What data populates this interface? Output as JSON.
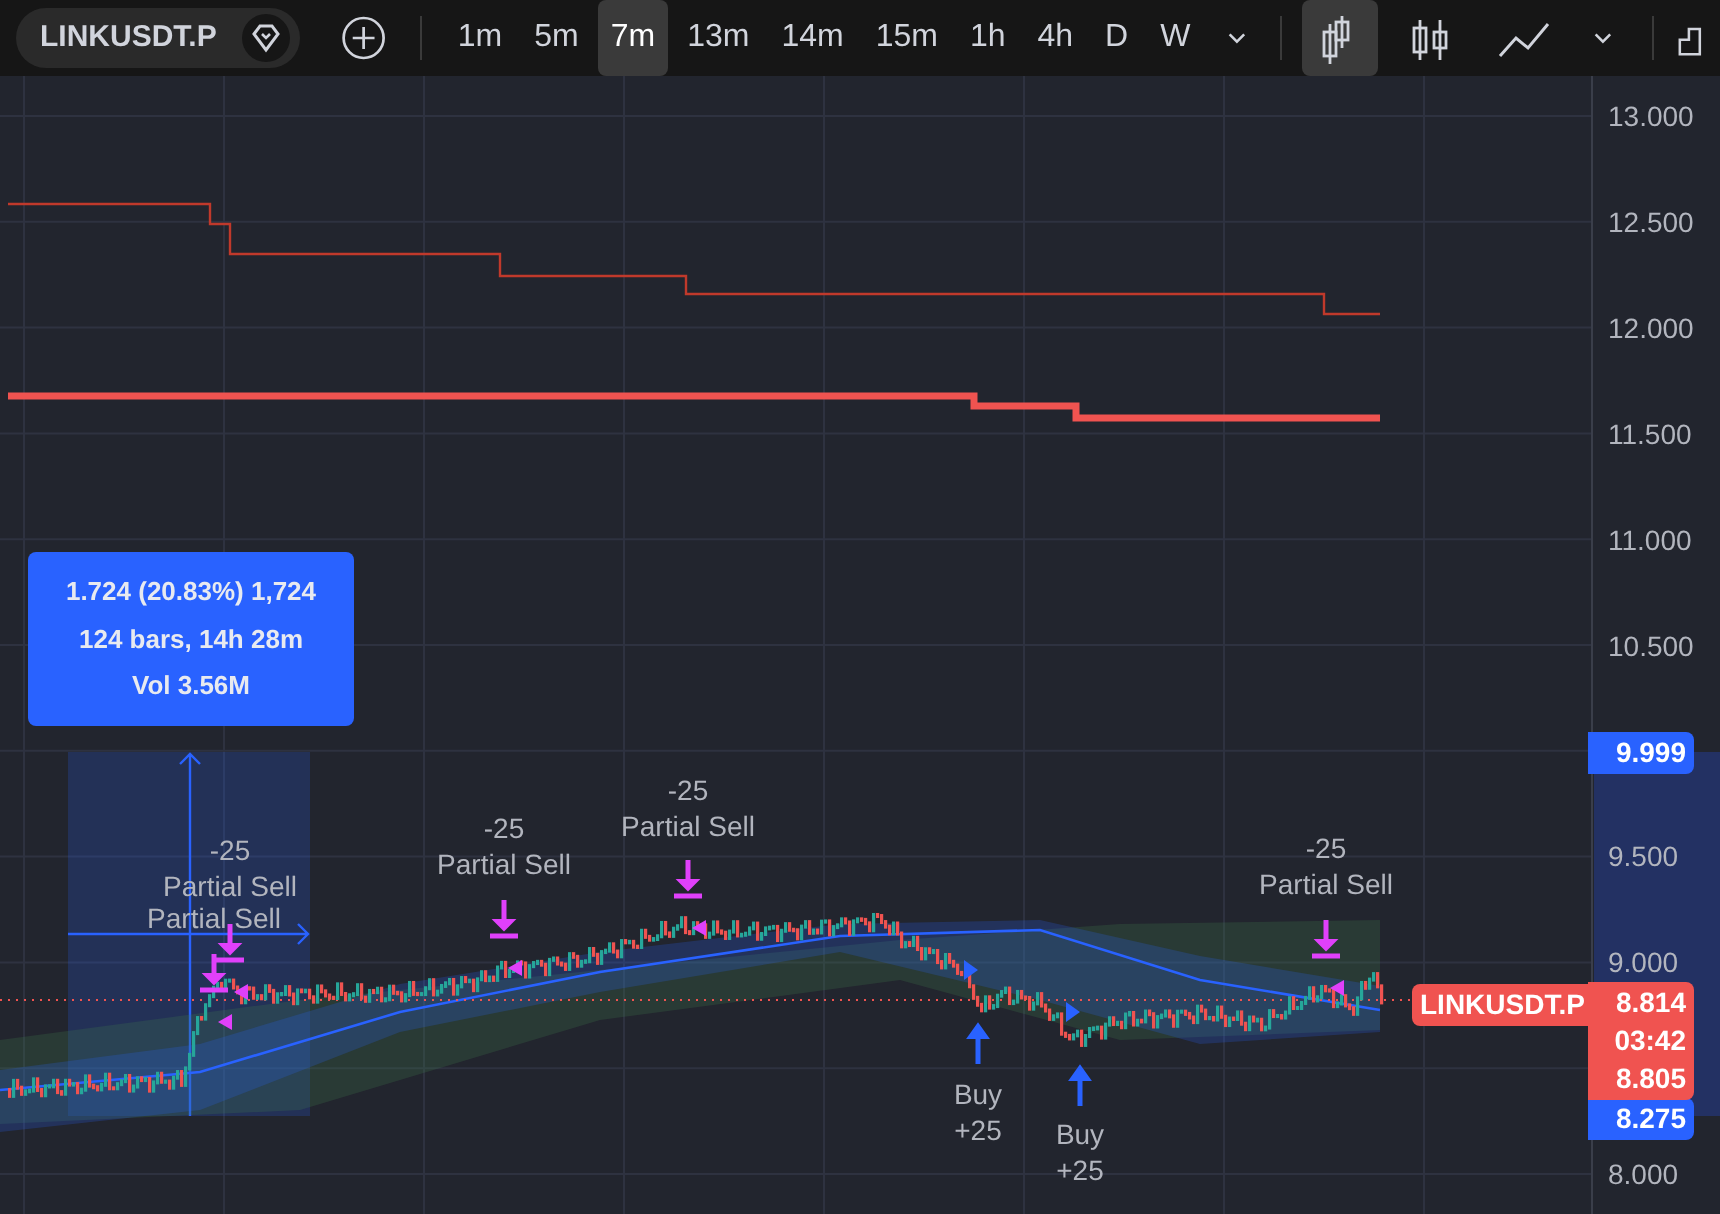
{
  "toolbar": {
    "symbol": "LINKUSDT.P",
    "intervals": [
      {
        "label": "1m",
        "selected": false
      },
      {
        "label": "5m",
        "selected": false
      },
      {
        "label": "7m",
        "selected": true
      },
      {
        "label": "13m",
        "selected": false
      },
      {
        "label": "14m",
        "selected": false
      },
      {
        "label": "15m",
        "selected": false
      },
      {
        "label": "1h",
        "selected": false
      },
      {
        "label": "4h",
        "selected": false
      },
      {
        "label": "D",
        "selected": false
      },
      {
        "label": "W",
        "selected": false
      }
    ],
    "chart_types": [
      {
        "kind": "candles",
        "selected": true
      },
      {
        "kind": "bars",
        "selected": false
      },
      {
        "kind": "line",
        "selected": false
      }
    ]
  },
  "price_axis": {
    "ticks": [
      "13.000",
      "12.500",
      "12.000",
      "11.500",
      "11.000",
      "10.500",
      "9.500",
      "9.000",
      "8.000"
    ],
    "range_labels": [
      "9.999",
      "8.275"
    ],
    "last_price": {
      "symbol": "LINKUSDT.P",
      "price": "8.814",
      "countdown": "03:42",
      "previous": "8.805"
    }
  },
  "measure_box": {
    "lines": [
      "1.724 (20.83%) 1,724",
      "124 bars, 14h 28m",
      "Vol 3.56M"
    ]
  },
  "markers": [
    {
      "kind": "sell",
      "qty": "-25",
      "label": "Partial Sell"
    },
    {
      "kind": "sell",
      "label": "Partial Sell"
    },
    {
      "kind": "sell",
      "qty": "-25",
      "label": "Partial Sell"
    },
    {
      "kind": "sell",
      "qty": "-25",
      "label": "Partial Sell"
    },
    {
      "kind": "sell",
      "qty": "-25",
      "label": "Partial Sell"
    },
    {
      "kind": "buy",
      "qty": "+25",
      "label": "Buy"
    },
    {
      "kind": "buy",
      "qty": "+25",
      "label": "Buy"
    }
  ]
}
